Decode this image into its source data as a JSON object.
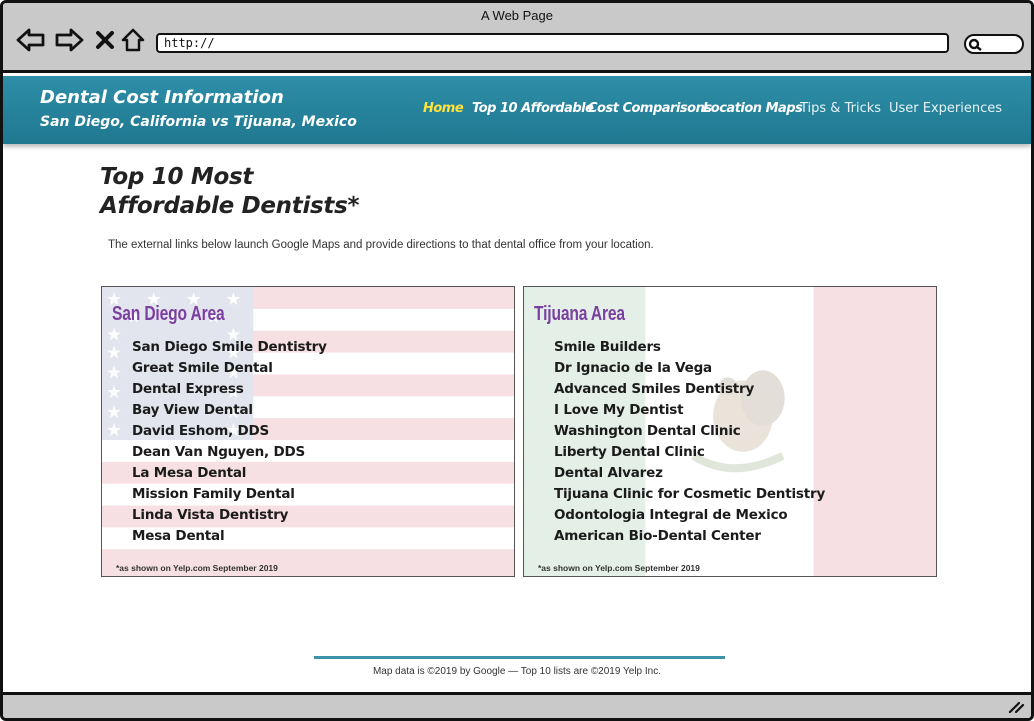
{
  "window": {
    "title": "A Web Page"
  },
  "browser": {
    "url": "http://",
    "icons": [
      "back-arrow-icon",
      "forward-arrow-icon",
      "close-x-icon",
      "home-icon",
      "search-icon"
    ]
  },
  "site": {
    "title": "Dental Cost Information",
    "subtitle": "San Diego, California vs Tijuana, Mexico",
    "nav": [
      {
        "label": "Home",
        "active": true
      },
      {
        "label": "Top 10 Affordable"
      },
      {
        "label": "Cost Comparisons"
      },
      {
        "label": "Location Maps"
      },
      {
        "label": "Tips & Tricks"
      },
      {
        "label": "User Experiences"
      }
    ]
  },
  "main": {
    "title_line1": "Top 10 Most",
    "title_line2": "Affordable Dentists*",
    "intro": "The external links below launch Google Maps and provide directions to that dental office from your location."
  },
  "panels": {
    "san_diego": {
      "title": "San Diego Area",
      "items": [
        "San Diego Smile Dentistry",
        "Great Smile Dental",
        "Dental Express",
        "Bay View Dental",
        "David Eshom, DDS",
        "Dean Van Nguyen, DDS",
        "La Mesa Dental",
        "Mission Family Dental",
        "Linda Vista Dentistry",
        "Mesa Dental"
      ],
      "note": "*as shown on Yelp.com September 2019"
    },
    "tijuana": {
      "title": "Tijuana Area",
      "items": [
        "Smile Builders",
        "Dr Ignacio de la Vega",
        "Advanced Smiles Dentistry",
        "I Love My Dentist",
        "Washington Dental Clinic",
        "Liberty Dental Clinic",
        "Dental Alvarez",
        "Tijuana Clinic for Cosmetic Dentistry",
        "Odontologia Integral de Mexico",
        "American Bio-Dental Center"
      ],
      "note": "*as shown on Yelp.com September 2019"
    }
  },
  "footer": {
    "text": "Map data is ©2019 by Google — Top 10 lists are ©2019 Yelp Inc."
  },
  "colors": {
    "header": "#2a869f",
    "active_nav": "#ffe23b",
    "panel_title": "#7a3fa0",
    "footer_line": "#3a93a8"
  }
}
